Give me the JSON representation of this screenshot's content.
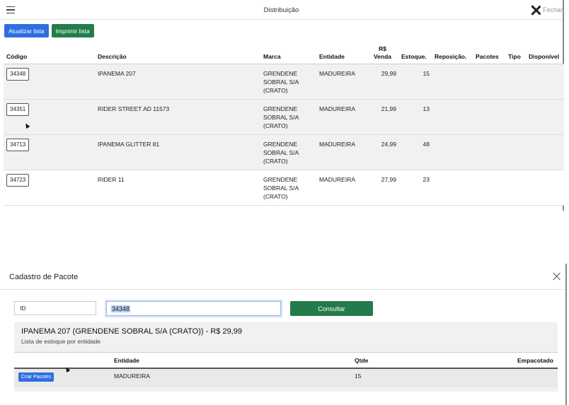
{
  "topbar": {
    "title": "Distribuição",
    "close_label": "Fechar"
  },
  "actions": {
    "refresh_label": "Atualizar lista",
    "print_label": "Imprimir lista"
  },
  "stock_table": {
    "headers": {
      "codigo": "Código",
      "descricao": "Descrição",
      "marca": "Marca",
      "entidade": "Entidade",
      "venda_top": "R$",
      "venda_bottom": "Venda",
      "estoque": "Estoque.",
      "reposicao": "Reposição.",
      "pacotes": "Pacotes",
      "tipo": "Tipo",
      "disponivel": "Disponível"
    },
    "rows": [
      {
        "codigo": "34348",
        "descricao": "IPANEMA 207",
        "marca_1": "GRENDENE",
        "marca_2": "SOBRAL S/A",
        "marca_3": "(CRATO)",
        "entidade": "MADUREIRA",
        "venda": "29,99",
        "estoque": "15"
      },
      {
        "codigo": "34351",
        "descricao": "RIDER STREET AD 11573",
        "marca_1": "GRENDENE",
        "marca_2": "SOBRAL S/A",
        "marca_3": "(CRATO)",
        "entidade": "MADUREIRA",
        "venda": "21,99",
        "estoque": "13"
      },
      {
        "codigo": "34713",
        "descricao": "IPANEMA GLITTER 81",
        "marca_1": "GRENDENE",
        "marca_2": "SOBRAL S/A",
        "marca_3": "(CRATO)",
        "entidade": "MADUREIRA",
        "venda": "24,99",
        "estoque": "48"
      },
      {
        "codigo": "34723",
        "descricao": "RIDER 11",
        "marca_1": "GRENDENE",
        "marca_2": "SOBRAL S/A",
        "marca_3": "(CRATO)",
        "entidade": "MADUREIRA",
        "venda": "27,99",
        "estoque": "23"
      }
    ]
  },
  "modal": {
    "title": "Cadastro de Pacote",
    "id_value": "ID",
    "code_value": "34348",
    "consult_label": "Consultar",
    "product_title": "IPANEMA 207 (GRENDENE SOBRAL S/A (CRATO)) - R$ 29,99",
    "product_subtitle": "Lista de estoque por entidade",
    "table": {
      "headers": {
        "entidade": "Entidade",
        "qtde": "Qtde",
        "empacotado": "Empacotado"
      },
      "rows": [
        {
          "button_label": "Criar Pacotes",
          "entidade": "MADUREIRA",
          "qtde": "15",
          "empacotado": ""
        }
      ]
    }
  },
  "colors": {
    "primary_blue": "#2f6ee2",
    "success_green": "#227d4a"
  }
}
